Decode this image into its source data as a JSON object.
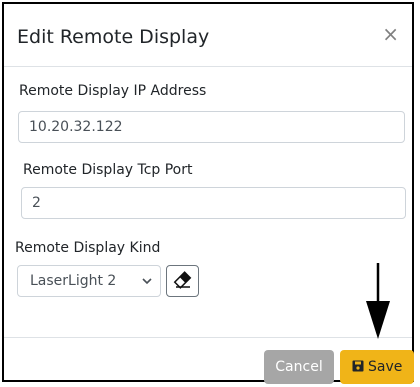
{
  "dialog": {
    "title": "Edit Remote Display",
    "close_glyph": "×"
  },
  "form": {
    "ip": {
      "label": "Remote Display IP Address",
      "value": "10.20.32.122"
    },
    "port": {
      "label": "Remote Display Tcp Port",
      "value": "2"
    },
    "kind": {
      "label": "Remote Display Kind",
      "selected": "LaserLight 2",
      "clear_icon": "eraser-icon"
    }
  },
  "footer": {
    "cancel_label": "Cancel",
    "save_label": "Save",
    "save_icon": "save-icon"
  },
  "colors": {
    "save_bg": "#f0b418",
    "cancel_bg": "#a6a6a6"
  }
}
